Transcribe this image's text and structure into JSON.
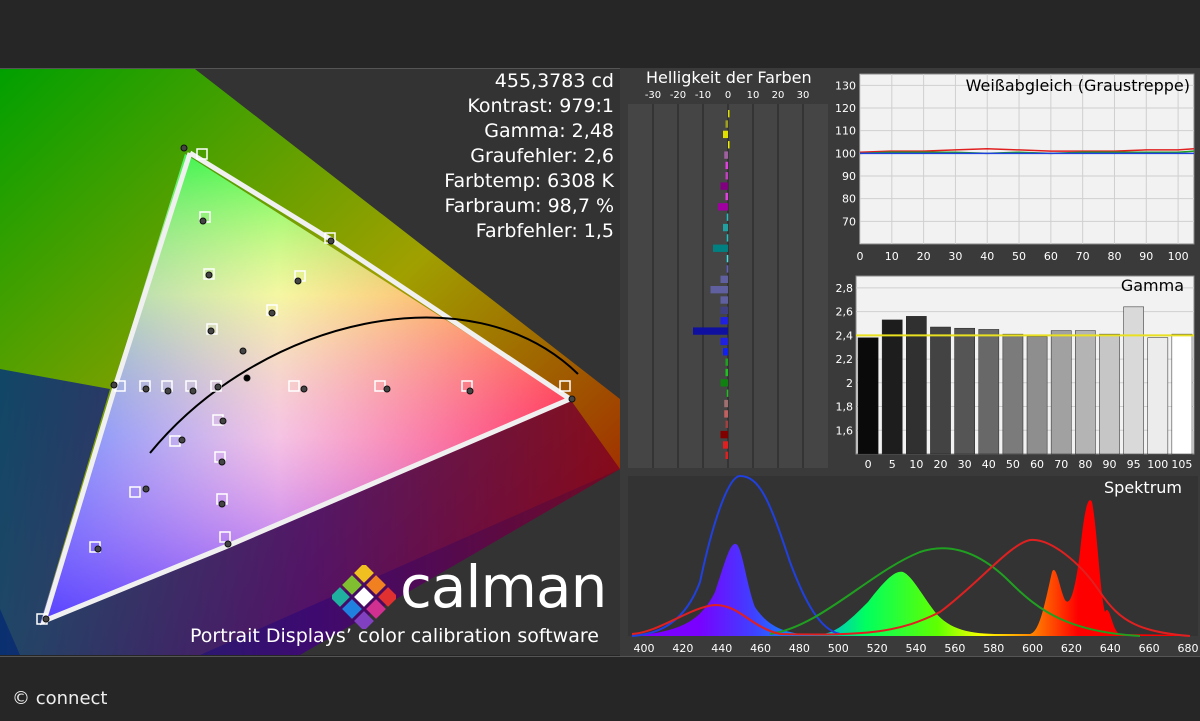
{
  "stats": {
    "luminance": "455,3783 cd",
    "contrast": "Kontrast: 979:1",
    "gamma": "Gamma: 2,48",
    "gray_error": "Graufehler: 2,6",
    "color_temp": "Farbtemp: 6308 K",
    "color_space": "Farbraum: 98,7 %",
    "color_error": "Farbfehler: 1,5"
  },
  "branding": {
    "logo_text": "calman",
    "tagline": "Portrait Displays’ color calibration software"
  },
  "credit": "© connect",
  "colors": {
    "red": "#e02020",
    "green": "#20a020",
    "blue": "#2040e0",
    "yellow": "#e8e020"
  },
  "panels": {
    "brightness": {
      "title": "Helligkeit der Farben",
      "ticks": [
        "-30",
        "-20",
        "-10",
        "0",
        "10",
        "20",
        "30"
      ]
    },
    "whitebalance": {
      "title": "Weißabgleich (Graustreppe)",
      "y_ticks": [
        "130",
        "120",
        "110",
        "100",
        "90",
        "80",
        "70"
      ],
      "x_ticks": [
        "0",
        "10",
        "20",
        "30",
        "40",
        "50",
        "60",
        "70",
        "80",
        "90",
        "100"
      ]
    },
    "gamma": {
      "title": "Gamma",
      "y_ticks": [
        "2,8",
        "2,6",
        "2,4",
        "2,2",
        "2",
        "1,8",
        "1,6"
      ],
      "x_ticks": [
        "0",
        "5",
        "10",
        "20",
        "30",
        "40",
        "50",
        "60",
        "70",
        "80",
        "90",
        "95",
        "100",
        "105"
      ]
    },
    "spectrum": {
      "title": "Spektrum",
      "x_ticks": [
        "400",
        "420",
        "440",
        "460",
        "480",
        "500",
        "520",
        "540",
        "560",
        "580",
        "600",
        "620",
        "640",
        "660",
        "680"
      ]
    }
  },
  "chart_data": [
    {
      "type": "bar",
      "title": "Helligkeit der Farben",
      "xlim": [
        -30,
        30
      ],
      "values": [
        0.5,
        -1,
        -2,
        0.5,
        -1.5,
        -1,
        -1,
        -3,
        -1,
        -4,
        -0.5,
        -2,
        -0.5,
        -6,
        -0.5,
        -0.5,
        -3,
        -7,
        -3,
        -3,
        -3,
        -14,
        -3,
        -2,
        -1,
        -1,
        -3,
        -0.5,
        -1.5,
        -1.5,
        -1,
        -3,
        -2,
        -1
      ]
    },
    {
      "type": "line",
      "title": "Weißabgleich (Graustreppe)",
      "x": [
        0,
        10,
        20,
        30,
        40,
        50,
        60,
        70,
        80,
        90,
        100,
        105
      ],
      "ylim": [
        60,
        135
      ],
      "series": [
        {
          "name": "R",
          "values": [
            100.5,
            101,
            101,
            101.5,
            102,
            101.5,
            101,
            101,
            101,
            101.5,
            101.5,
            102
          ]
        },
        {
          "name": "G",
          "values": [
            100,
            100.5,
            100.5,
            100.5,
            100,
            100.5,
            100,
            100.5,
            100.5,
            100.5,
            100.5,
            101
          ]
        },
        {
          "name": "B",
          "values": [
            100,
            100,
            100,
            100,
            100,
            100,
            100,
            100,
            100,
            100,
            100,
            100
          ]
        }
      ]
    },
    {
      "type": "bar",
      "title": "Gamma",
      "categories": [
        "0",
        "5",
        "10",
        "20",
        "30",
        "40",
        "50",
        "60",
        "70",
        "80",
        "90",
        "95",
        "100",
        "105"
      ],
      "values": [
        2.38,
        2.53,
        2.56,
        2.47,
        2.46,
        2.45,
        2.41,
        2.39,
        2.44,
        2.44,
        2.41,
        2.64,
        2.38,
        2.41
      ],
      "target": 2.4,
      "ylim": [
        1.4,
        2.9
      ]
    }
  ]
}
